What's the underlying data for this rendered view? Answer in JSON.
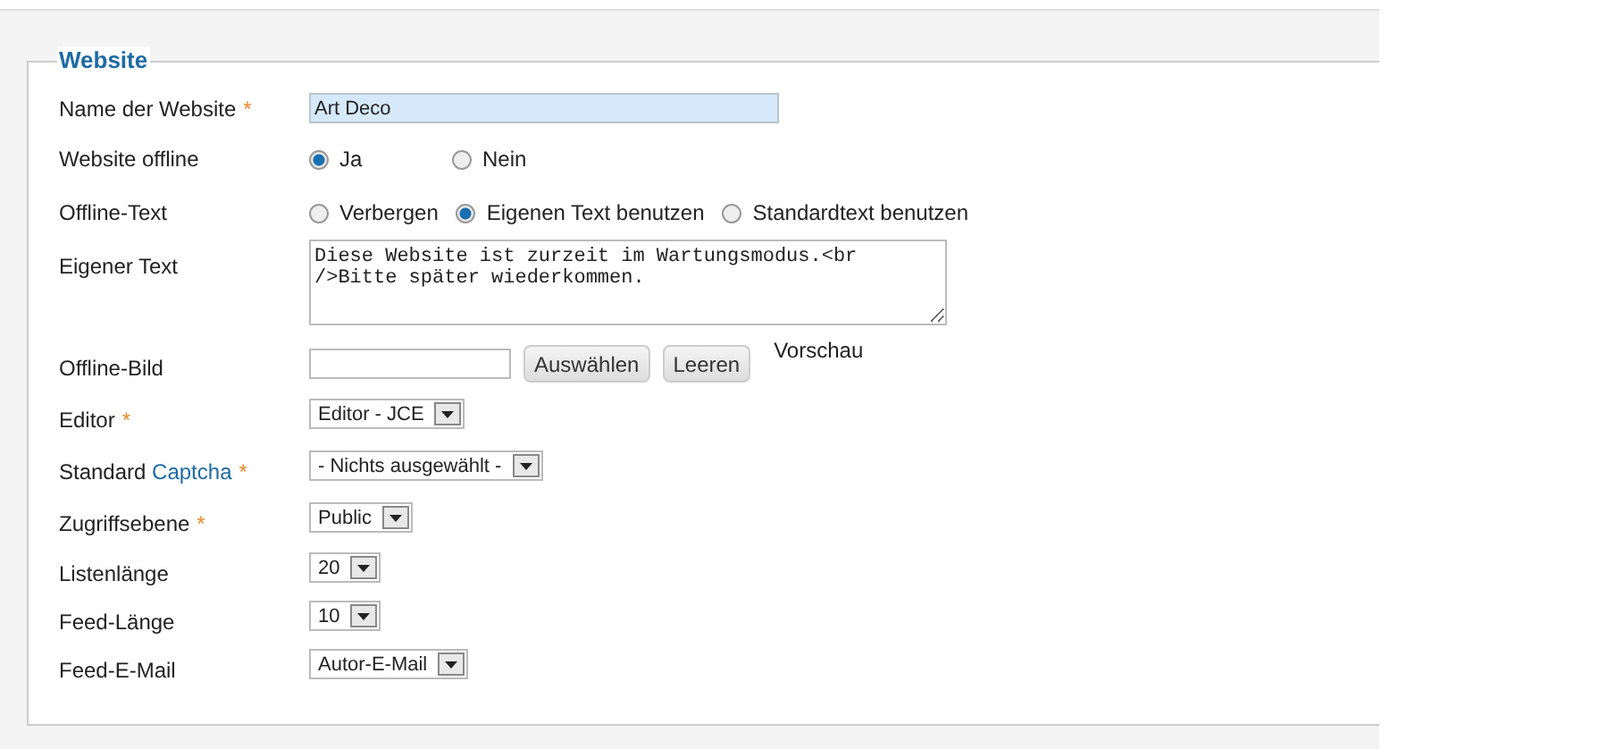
{
  "legend": "Website",
  "rows": [
    {
      "kind": "text",
      "label": "Name der Website",
      "required_mark": "*",
      "value": "Art Deco",
      "highlighted": true
    },
    {
      "kind": "radio",
      "label": "Website offline",
      "options": [
        {
          "label": "Ja",
          "selected": true
        },
        {
          "label": "Nein",
          "selected": false
        }
      ]
    },
    {
      "kind": "radio",
      "label": "Offline-Text",
      "options": [
        {
          "label": "Verbergen",
          "selected": false
        },
        {
          "label": "Eigenen Text benutzen",
          "selected": true
        },
        {
          "label": "Standardtext benutzen",
          "selected": false
        }
      ]
    },
    {
      "kind": "textarea",
      "label": "Eigener Text",
      "value": "Diese Website ist zurzeit im Wartungsmodus.<br />Bitte später wiederkommen."
    },
    {
      "kind": "media",
      "label": "Offline-Bild",
      "buttons": [
        "Auswählen",
        "Leeren"
      ],
      "preview": "Vorschau"
    },
    {
      "kind": "select",
      "label": "Editor",
      "required_mark": "*",
      "value": "Editor - JCE"
    },
    {
      "kind": "select",
      "label": "Standard",
      "link": "Captcha",
      "required_mark": "*",
      "value": "- Nichts ausgewählt -"
    },
    {
      "kind": "select",
      "label": "Zugriffsebene",
      "required_mark": "*",
      "value": "Public"
    },
    {
      "kind": "select",
      "label": "Listenlänge",
      "value": "20"
    },
    {
      "kind": "select",
      "label": "Feed-Länge",
      "value": "10"
    },
    {
      "kind": "select",
      "label": "Feed-E-Mail",
      "value": "Autor-E-Mail"
    }
  ]
}
